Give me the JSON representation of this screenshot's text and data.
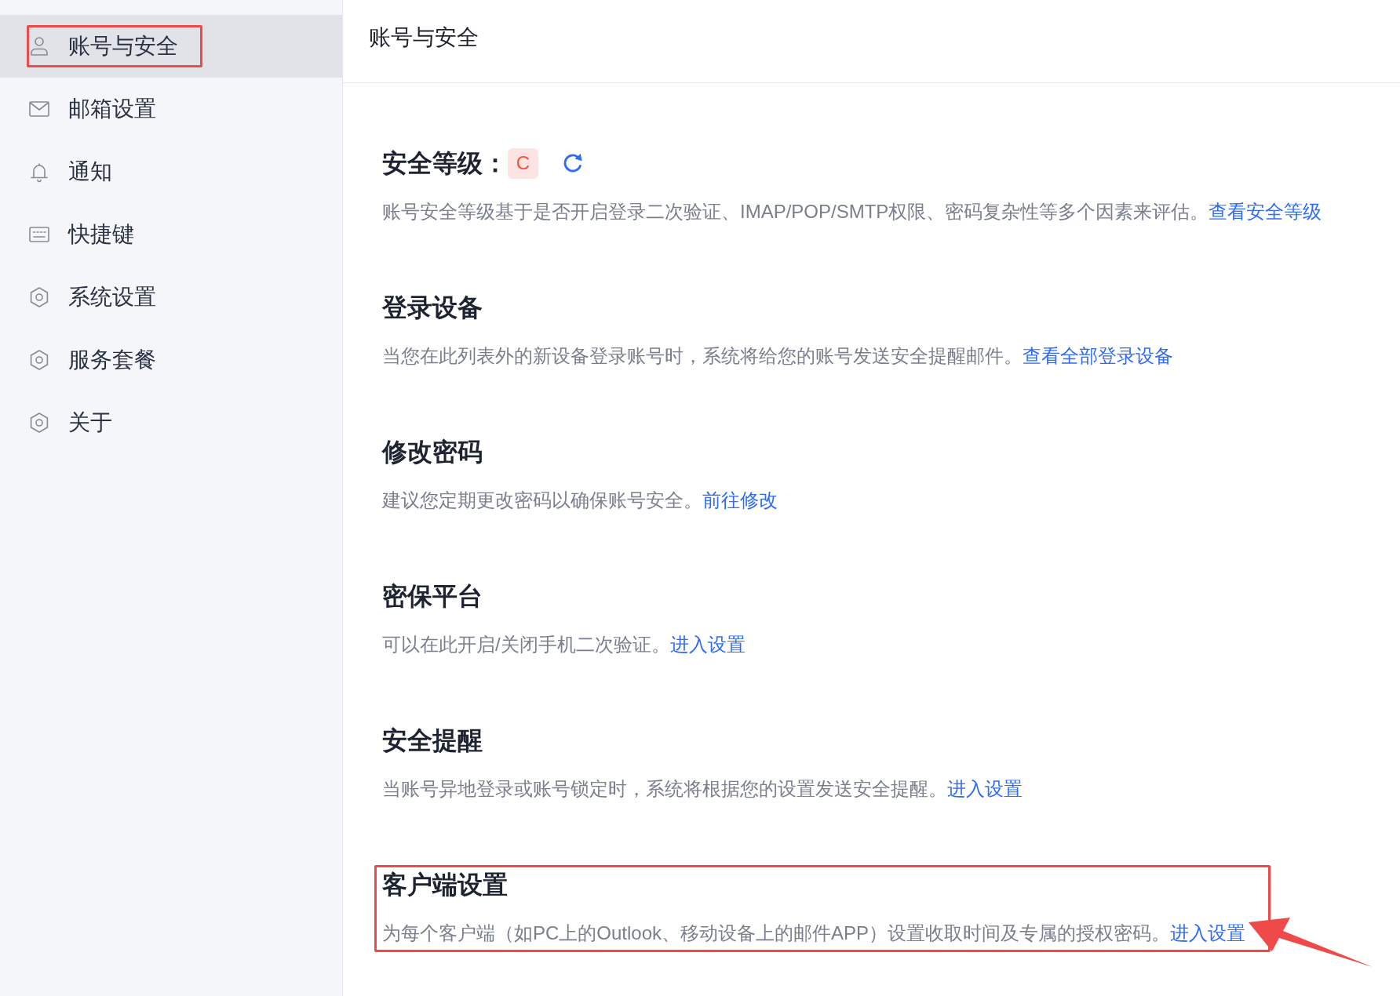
{
  "sidebar": {
    "items": [
      {
        "label": "账号与安全",
        "selected": true,
        "highlighted": true
      },
      {
        "label": "邮箱设置",
        "selected": false,
        "highlighted": false
      },
      {
        "label": "通知",
        "selected": false,
        "highlighted": false
      },
      {
        "label": "快捷键",
        "selected": false,
        "highlighted": false
      },
      {
        "label": "系统设置",
        "selected": false,
        "highlighted": false
      },
      {
        "label": "服务套餐",
        "selected": false,
        "highlighted": false
      },
      {
        "label": "关于",
        "selected": false,
        "highlighted": false
      }
    ]
  },
  "page": {
    "title": "账号与安全"
  },
  "sections": [
    {
      "kind": "grade",
      "heading": "安全等级：",
      "grade": "C",
      "description": "账号安全等级基于是否开启登录二次验证、IMAP/POP/SMTP权限、密码复杂性等多个因素来评估。",
      "link": "查看安全等级",
      "highlighted": false,
      "arrow": false
    },
    {
      "kind": "plain",
      "heading": "登录设备",
      "description": "当您在此列表外的新设备登录账号时，系统将给您的账号发送安全提醒邮件。",
      "link": "查看全部登录设备",
      "highlighted": false,
      "arrow": false
    },
    {
      "kind": "plain",
      "heading": "修改密码",
      "description": "建议您定期更改密码以确保账号安全。",
      "link": "前往修改",
      "highlighted": false,
      "arrow": false
    },
    {
      "kind": "plain",
      "heading": "密保平台",
      "description": "可以在此开启/关闭手机二次验证。",
      "link": "进入设置",
      "highlighted": false,
      "arrow": false
    },
    {
      "kind": "plain",
      "heading": "安全提醒",
      "description": "当账号异地登录或账号锁定时，系统将根据您的设置发送安全提醒。",
      "link": "进入设置",
      "highlighted": false,
      "arrow": false
    },
    {
      "kind": "plain",
      "heading": "客户端设置",
      "description": "为每个客户端（如PC上的Outlook、移动设备上的邮件APP）设置收取时间及专属的授权密码。",
      "link": "进入设置",
      "highlighted": true,
      "arrow": true
    }
  ]
}
